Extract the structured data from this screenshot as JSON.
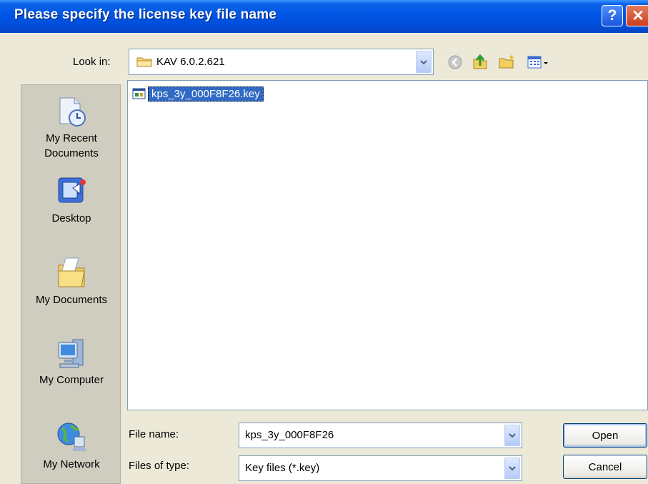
{
  "window": {
    "title": "Please specify the license key file name"
  },
  "lookin": {
    "label": "Look in:",
    "value": "KAV 6.0.2.621"
  },
  "places": [
    {
      "label": "My Recent Documents"
    },
    {
      "label": "Desktop"
    },
    {
      "label": "My Documents"
    },
    {
      "label": "My Computer"
    },
    {
      "label": "My Network"
    }
  ],
  "files": [
    {
      "name": "kps_3y_000F8F26.key",
      "selected": true
    }
  ],
  "filename": {
    "label": "File name:",
    "value": "kps_3y_000F8F26"
  },
  "filetype": {
    "label": "Files of type:",
    "value": "Key files (*.key)"
  },
  "buttons": {
    "open": "Open",
    "cancel": "Cancel"
  },
  "colors": {
    "titlebar": "#0055e5",
    "selection": "#316ac5",
    "dialog_bg": "#ece9d8"
  }
}
